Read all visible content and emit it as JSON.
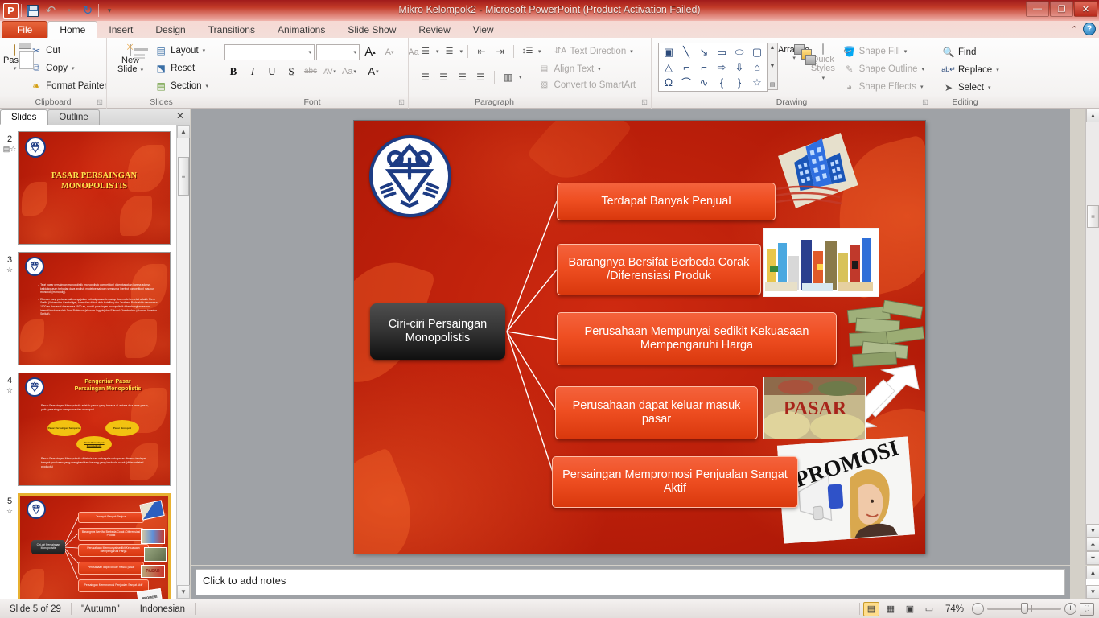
{
  "window": {
    "title": "Mikro Kelompok2  -  Microsoft PowerPoint (Product Activation Failed)",
    "app_logo": "P",
    "minimize": "—",
    "restore": "❐",
    "close": "✕",
    "qat": [
      {
        "name": "save-icon",
        "label": "Save"
      },
      {
        "name": "undo-icon",
        "label": "↶"
      },
      {
        "name": "undo-dropdown-icon",
        "label": "▾"
      },
      {
        "name": "redo-icon",
        "label": "↻"
      },
      {
        "name": "customize-qat-icon",
        "label": "▾"
      }
    ]
  },
  "ribbon": {
    "tabs": [
      {
        "label": "File",
        "active": false,
        "file": true
      },
      {
        "label": "Home",
        "active": true
      },
      {
        "label": "Insert",
        "active": false
      },
      {
        "label": "Design",
        "active": false
      },
      {
        "label": "Transitions",
        "active": false
      },
      {
        "label": "Animations",
        "active": false
      },
      {
        "label": "Slide Show",
        "active": false
      },
      {
        "label": "Review",
        "active": false
      },
      {
        "label": "View",
        "active": false
      }
    ],
    "minimize_ribbon": "⌃",
    "help": "?",
    "groups": {
      "clipboard": {
        "label": "Clipboard",
        "paste": "Paste",
        "paste_caret": "▾",
        "items": [
          {
            "label": "Cut",
            "icon": "scissors-icon",
            "glyph": "✂"
          },
          {
            "label": "Copy",
            "icon": "copy-icon",
            "glyph": "⧉",
            "caret": "▾"
          },
          {
            "label": "Format Painter",
            "icon": "paintbrush-icon",
            "glyph": "🖌"
          }
        ]
      },
      "slides": {
        "label": "Slides",
        "new_slide": "New\nSlide",
        "new_slide_line1": "New",
        "new_slide_line2": "Slide",
        "new_slide_caret": "▾",
        "items": [
          {
            "label": "Layout",
            "icon": "layout-icon",
            "caret": "▾"
          },
          {
            "label": "Reset",
            "icon": "reset-icon",
            "caret": ""
          },
          {
            "label": "Section",
            "icon": "section-icon",
            "caret": "▾"
          }
        ]
      },
      "font": {
        "label": "Font",
        "font_name": "",
        "font_size": "",
        "grow_font": "A",
        "shrink_font": "A",
        "clear_formatting": "Aa",
        "bold": "B",
        "italic": "I",
        "underline": "U",
        "shadow": "S",
        "strikethrough": "abc",
        "char_spacing": "AV",
        "change_case": "Aa",
        "font_color": "A"
      },
      "paragraph": {
        "label": "Paragraph",
        "bullets": "☰",
        "numbering": "☰",
        "decrease_indent": "⇤",
        "increase_indent": "⇥",
        "line_spacing": "↕☰",
        "align_left": "☰",
        "align_center": "☰",
        "align_right": "☰",
        "justify": "☰",
        "columns": "▥",
        "text_direction": "Text Direction",
        "align_text": "Align Text",
        "convert_smartart": "Convert to SmartArt"
      },
      "drawing": {
        "label": "Drawing",
        "shapes": [
          "▣",
          "╲",
          "↘",
          "▭",
          "⬭",
          "▢",
          "△",
          "⌐",
          "⌐",
          "⇨",
          "⇩",
          "⌂",
          "ᘯ",
          "⌒",
          "∿",
          "{",
          "}",
          "☆"
        ],
        "arrange": "Arrange",
        "arrange_caret": "▾",
        "quick_styles_l1": "Quick",
        "quick_styles_l2": "Styles",
        "quick_styles_caret": "▾",
        "shape_fill": "Shape Fill",
        "shape_outline": "Shape Outline",
        "shape_effects": "Shape Effects"
      },
      "editing": {
        "label": "Editing",
        "items": [
          {
            "label": "Find",
            "icon": "binoculars-icon",
            "caret": ""
          },
          {
            "label": "Replace",
            "icon": "replace-icon",
            "caret": "▾"
          },
          {
            "label": "Select",
            "icon": "cursor-icon",
            "caret": "▾"
          }
        ]
      }
    }
  },
  "left_pane": {
    "tabs": [
      {
        "label": "Slides",
        "active": true
      },
      {
        "label": "Outline",
        "active": false
      }
    ],
    "close": "✕",
    "thumbnails": [
      {
        "number": "2",
        "selected": false,
        "kind": "title",
        "title_line1": "PASAR  PERSAINGAN",
        "title_line2": "MONOPOLISTIS"
      },
      {
        "number": "3",
        "selected": false,
        "kind": "bullets",
        "bullets": [
          "Teori pasar persaingan monopolistik (monopolistic competition) dikembangkan karena adanya ketidakpuasan terhadap daya analisis model persaingan sempurna (perfect competition) maupun monopoli (monopoly).",
          "Ekonom yang pertama kali mengajukan ketidakpuasan terhadap dua model tersebut adalah Piero Sraffa (Universitas Cambridge), kemudian diikuti oleh Hotelling dan Zeuthen. Pada akhir dasawarsa 1920-an dan awal dasawarsa 1930-an, model persaingan monopolistik dikembangkan secara intensif terutama oleh Joan Robinson (ekonom Inggris) dan Edward Chamberlain (ekonom Amerika Serikat)."
        ]
      },
      {
        "number": "4",
        "selected": false,
        "kind": "definition",
        "title_line1": "Pengertian  Pasar",
        "title_line2": "Persaingan  Monopolistis",
        "para1": "Pasar Persaingan Monopolistis adalah pasar yang berada di antara dua jenis pasar, yaitu persaingan sempurna dan monopoli.",
        "oval1": "Pasar Persaingan Sempurna",
        "oval2": "Pasar Monopoli",
        "oval3": "Pasar Persaingan Monopolistis",
        "para2": "Pasar Persaingan Monopolistis didefinisikan sebagai suatu pasar dimana terdapat banyak produsen yang menghasilkan barang yang berbeda corak (differentiated products)"
      },
      {
        "number": "5",
        "selected": true,
        "kind": "diagram"
      }
    ],
    "scroll_up": "▲",
    "scroll_down": "▼",
    "scroll_grip": "≡"
  },
  "slide": {
    "center_node": "Ciri-ciri Persaingan Monopolistis",
    "nodes": [
      {
        "id": "n1",
        "text": "Terdapat Banyak Penjual"
      },
      {
        "id": "n2",
        "text": "Barangnya Bersifat Berbeda Corak /Diferensiasi Produk"
      },
      {
        "id": "n3",
        "text": "Perusahaan Mempunyai sedikit Kekuasaan Mempengaruhi Harga"
      },
      {
        "id": "n4",
        "text": "Perusahaan dapat keluar masuk pasar"
      },
      {
        "id": "n5",
        "text": "Persaingan Mempromosi Penjualan Sangat Aktif"
      }
    ],
    "images": [
      {
        "name": "buildings-image",
        "alt": "blue office buildings on cream card"
      },
      {
        "name": "products-image",
        "alt": "assorted consumer products"
      },
      {
        "name": "money-image",
        "alt": "stacks of dollar bills"
      },
      {
        "name": "arrows-image",
        "alt": "two white arrows in and out"
      },
      {
        "name": "market-image",
        "alt": "traditional market with PASAR caption"
      },
      {
        "name": "promosi-image",
        "alt": "woman shouting into megaphone with PROMOSI caption"
      }
    ],
    "market_caption": "PASAR",
    "promosi_caption": "PROMOSI",
    "logo_alt": "university emblem"
  },
  "notes": {
    "placeholder": "Click to add notes"
  },
  "status_bar": {
    "slide_counter": "Slide 5 of 29",
    "theme": "\"Autumn\"",
    "language": "Indonesian",
    "zoom_level": "74%",
    "views": [
      {
        "name": "normal-view-button",
        "glyph": "▤",
        "active": true
      },
      {
        "name": "slide-sorter-button",
        "glyph": "▦",
        "active": false
      },
      {
        "name": "reading-view-button",
        "glyph": "▣",
        "active": false
      },
      {
        "name": "slide-show-button",
        "glyph": "▭",
        "active": false
      }
    ],
    "zoom_out": "−",
    "zoom_in": "+",
    "fit_to_window": "⛶"
  },
  "colors": {
    "slide_red_dark": "#a81505",
    "slide_red_light": "#cf2a10",
    "node_orange": "#ef4f22",
    "center_black": "#1d1d1d",
    "logo_blue": "#1d3c84",
    "title_yellow": "#ffe14d",
    "ribbon_accent": "#d24726",
    "selected_thumb_border": "#e8b130"
  }
}
